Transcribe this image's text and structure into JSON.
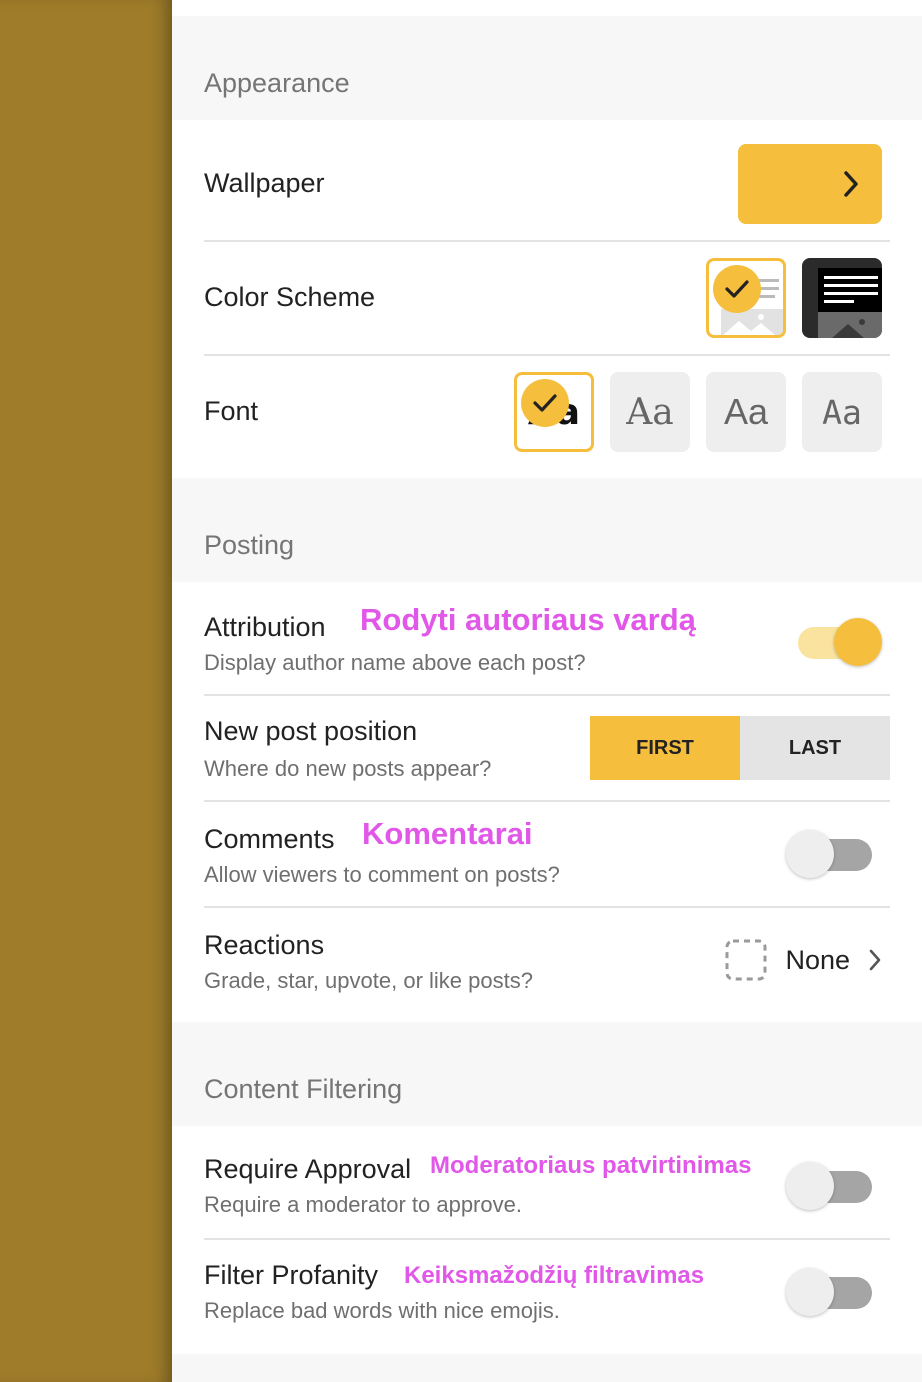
{
  "colors": {
    "accent": "#f6be3d",
    "annotation": "#e157e8",
    "wallpaper": "#9e7c2a"
  },
  "appearance": {
    "header": "Appearance",
    "wallpaper": {
      "label": "Wallpaper",
      "icon": "chevron-right-icon"
    },
    "color_scheme": {
      "label": "Color Scheme",
      "selected": "light"
    },
    "font": {
      "label": "Font",
      "options": [
        "Aa",
        "Aa",
        "Aa",
        "Aa"
      ],
      "selected_index": 0
    }
  },
  "posting": {
    "header": "Posting",
    "attribution": {
      "title": "Attribution",
      "subtitle": "Display author name above each post?",
      "annotation": "Rodyti autoriaus vardą",
      "enabled": true
    },
    "new_post_position": {
      "title": "New post position",
      "subtitle": "Where do new posts appear?",
      "options": [
        "FIRST",
        "LAST"
      ],
      "selected": "FIRST"
    },
    "comments": {
      "title": "Comments",
      "subtitle": "Allow viewers to comment on posts?",
      "annotation": "Komentarai",
      "enabled": false
    },
    "reactions": {
      "title": "Reactions",
      "subtitle": "Grade, star, upvote, or like posts?",
      "value": "None"
    }
  },
  "content_filtering": {
    "header": "Content Filtering",
    "require_approval": {
      "title": "Require Approval",
      "subtitle": "Require a moderator to approve.",
      "annotation": "Moderatoriaus patvirtinimas",
      "enabled": false
    },
    "filter_profanity": {
      "title": "Filter Profanity",
      "subtitle": "Replace bad words with nice emojis.",
      "annotation": "Keiksmažodžių filtravimas",
      "enabled": false
    }
  }
}
